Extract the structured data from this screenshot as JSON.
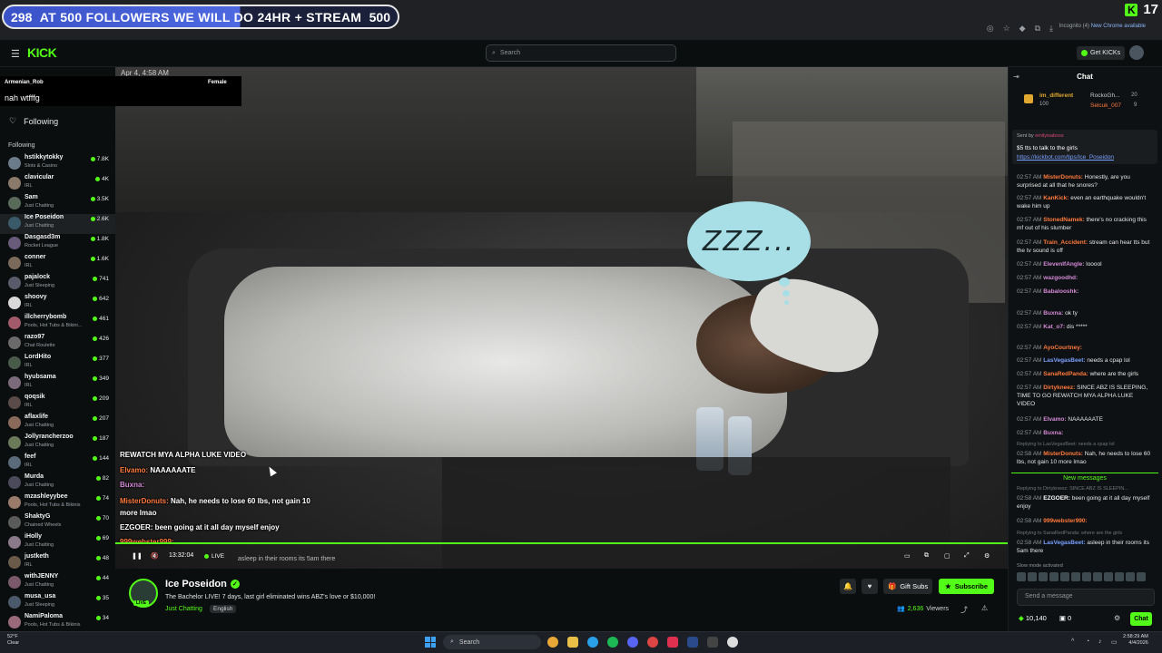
{
  "follow_goal": {
    "current": "298",
    "text": "AT 500 FOLLOWERS WE WILL DO 24HR + STREAM",
    "target": "500"
  },
  "corner_badge": {
    "value": "17"
  },
  "browser": {
    "incognito": "Incognito (4)",
    "new_chrome": "New Chrome available"
  },
  "header": {
    "search_placeholder": "Search",
    "get_kicks": "Get KICKs"
  },
  "popup": {
    "username": "Armenian_Rob",
    "gender": "Female",
    "message": "nah wtfffg"
  },
  "sidebar": {
    "nav_following": "Following",
    "section_title": "Following",
    "items": [
      {
        "name": "hstikkytokky",
        "category": "Slots & Casino",
        "viewers": "7.8K",
        "color": "#6b7b8a"
      },
      {
        "name": "clavicular",
        "category": "IRL",
        "viewers": "4K",
        "color": "#8a7a6a"
      },
      {
        "name": "Sam",
        "category": "Just Chatting",
        "viewers": "3.5K",
        "color": "#5a6a5a"
      },
      {
        "name": "Ice Poseidon",
        "category": "Just Chatting",
        "viewers": "2.6K",
        "color": "#3a5a6a"
      },
      {
        "name": "Dasgasd3m",
        "category": "Rocket League",
        "viewers": "1.8K",
        "color": "#6a5a7a"
      },
      {
        "name": "conner",
        "category": "IRL",
        "viewers": "1.6K",
        "color": "#7a6a5a"
      },
      {
        "name": "pajalock",
        "category": "Just Sleeping",
        "viewers": "741",
        "color": "#5a5a6a"
      },
      {
        "name": "shoovy",
        "category": "IRL",
        "viewers": "642",
        "color": "#d9d9d9"
      },
      {
        "name": "illcherrybomb",
        "category": "Pools, Hot Tubs & Bikini...",
        "viewers": "461",
        "color": "#a05a6a"
      },
      {
        "name": "razo97",
        "category": "Chat Roulette",
        "viewers": "426",
        "color": "#6a6a6a"
      },
      {
        "name": "LordHito",
        "category": "IRL",
        "viewers": "377",
        "color": "#4a5a4a"
      },
      {
        "name": "hyubsama",
        "category": "IRL",
        "viewers": "349",
        "color": "#7a6a7a"
      },
      {
        "name": "qoqsik",
        "category": "IRL",
        "viewers": "209",
        "color": "#5a4a4a"
      },
      {
        "name": "aflaxlife",
        "category": "Just Chatting",
        "viewers": "207",
        "color": "#8a6a5a"
      },
      {
        "name": "Jollyrancherzoo",
        "category": "Just Chatting",
        "viewers": "187",
        "color": "#6a7a5a"
      },
      {
        "name": "feef",
        "category": "IRL",
        "viewers": "144",
        "color": "#5a6a7a"
      },
      {
        "name": "Murda",
        "category": "Just Chatting",
        "viewers": "82",
        "color": "#4a4a5a"
      },
      {
        "name": "mzashleyybee",
        "category": "Pools, Hot Tubs & Bikinis",
        "viewers": "74",
        "color": "#9a7a6a"
      },
      {
        "name": "ShaktyG",
        "category": "Chained Wheels",
        "viewers": "70",
        "color": "#5a5a5a"
      },
      {
        "name": "iHolly",
        "category": "Just Chatting",
        "viewers": "69",
        "color": "#8a7a8a"
      },
      {
        "name": "justketh",
        "category": "IRL",
        "viewers": "48",
        "color": "#6a5a4a"
      },
      {
        "name": "withJENNY",
        "category": "Just Chatting",
        "viewers": "44",
        "color": "#7a5a6a"
      },
      {
        "name": "musa_usa",
        "category": "Just Sleeping",
        "viewers": "35",
        "color": "#4a5a6a"
      },
      {
        "name": "NamiPaloma",
        "category": "Pools, Hot Tubs & Bikinis",
        "viewers": "34",
        "color": "#9a6a7a"
      }
    ]
  },
  "video": {
    "timestamp_overlay": "Apr 4, 4:58 AM",
    "zzz": "ZZZ...",
    "overlay_chat": [
      {
        "user": "",
        "text": "REWATCH MYA ALPHA LUKE VIDEO",
        "cls": ""
      },
      {
        "user": "Elvamo:",
        "text": " NAAAAAATE",
        "cls": "u1"
      },
      {
        "user": "Buxna:",
        "text": "",
        "cls": "u2"
      },
      {
        "user": "MisterDonuts:",
        "text": " Nah, he needs to lose 60 lbs, not gain 10",
        "cls": "u1"
      },
      {
        "user": "",
        "text": "more lmao",
        "cls": ""
      },
      {
        "user": "EZGOER:",
        "text": " been going at it all day myself enjoy",
        "cls": ""
      },
      {
        "user": "999webster999:",
        "text": "",
        "cls": "u1"
      }
    ],
    "time": "13:32:04",
    "live": "LIVE",
    "overlay_bottom_text": "asleep in their rooms its 5am there"
  },
  "stream": {
    "name": "Ice Poseidon",
    "title": "The Bachelor LIVE! 7 days, last girl eliminated wins ABZ's love or $10,000!",
    "category": "Just Chatting",
    "language": "English",
    "gift_subs": "Gift Subs",
    "subscribe": "Subscribe",
    "viewers_count": "2,636",
    "viewers_label": "Viewers",
    "live_badge": "LIVE"
  },
  "chat": {
    "title": "Chat",
    "leaderboard": [
      {
        "name": "im_different",
        "value": "100"
      },
      {
        "name": "RockoGh...",
        "value": "20"
      },
      {
        "name": "Selcuk_007",
        "value": "9"
      }
    ],
    "pinned_sender": "Sent by",
    "pinned_sender_name": "emilyisaboss",
    "pinned_text": "$5 tts to talk to the girls",
    "pinned_link": "https://kickbot.com/tips/Ice_Poseidon",
    "messages": [
      {
        "time": "02:57 AM",
        "user": "MisterDonuts:",
        "text": " Honestly, are you surprised at all that he snores?",
        "color": "#ff7a3d"
      },
      {
        "time": "02:57 AM",
        "user": "KanKick:",
        "text": " even an earthquake wouldn't wake him up",
        "color": "#ff7a3d"
      },
      {
        "time": "02:57 AM",
        "user": "StonedNamek:",
        "text": " there's no cracking this mf out of his slumber",
        "color": "#ff7a3d"
      },
      {
        "time": "02:57 AM",
        "user": "Train_Accident:",
        "text": " stream can hear tts but the tv sound is off",
        "color": "#ff7a3d"
      },
      {
        "time": "02:57 AM",
        "user": "ElevenIfAngle:",
        "text": " looool",
        "color": "#d48ad6"
      },
      {
        "time": "02:57 AM",
        "user": "wazgoodhd:",
        "text": "",
        "color": "#d48ad6"
      },
      {
        "time": "02:57 AM",
        "user": "Babalooshk:",
        "text": "",
        "color": "#d48ad6"
      },
      {
        "time": "02:57 AM",
        "user": "Buxna:",
        "text": " ok ty",
        "color": "#d48ad6"
      },
      {
        "time": "02:57 AM",
        "user": "Kat_o7:",
        "text": " dis *****",
        "color": "#d48ad6"
      },
      {
        "time": "02:57 AM",
        "user": "AyoCourtney:",
        "text": "",
        "color": "#ff7a3d"
      },
      {
        "time": "02:57 AM",
        "user": "LasVegasBeet:",
        "text": " needs a cpap lol",
        "color": "#7aa0ff"
      },
      {
        "time": "02:57 AM",
        "user": "SanaRedPanda:",
        "text": " where are the girls",
        "color": "#ff7a3d"
      },
      {
        "time": "02:57 AM",
        "user": "Dirtykneez:",
        "text": " SINCE ABZ IS SLEEPING, TIME TO GO REWATCH MYA ALPHA LUKE VIDEO",
        "color": "#ff7a3d"
      },
      {
        "time": "02:57 AM",
        "user": "Elvamo:",
        "text": " NAAAAAATE",
        "color": "#d48ad6"
      },
      {
        "time": "02:57 AM",
        "user": "Buxna:",
        "text": "",
        "color": "#d48ad6"
      },
      {
        "time": "02:58 AM",
        "user": "MisterDonuts:",
        "text": " Nah, he needs to lose 60 lbs, not gain 10 more lmao",
        "color": "#ff7a3d"
      },
      {
        "time": "02:58 AM",
        "user": "EZGOER:",
        "text": " been going at it all day myself enjoy",
        "color": "#ffffff"
      },
      {
        "time": "02:58 AM",
        "user": "999webster990:",
        "text": "",
        "color": "#ff7a3d"
      },
      {
        "time": "02:58 AM",
        "user": "LasVegasBeet:",
        "text": " asleep in their rooms its 5am there",
        "color": "#7aa0ff"
      }
    ],
    "replies": [
      "Replying to LasVegasBeet: needs a cpap lol",
      "Replying to Dirtykneez: SINCE ABZ IS SLEEPIN...",
      "Replying to SanaRedPanda: where are the girls"
    ],
    "new_messages": "New messages",
    "slow_mode": "Slow mode activated",
    "input_placeholder": "Send a message",
    "kicks_balance": "10,140",
    "other_balance": "0",
    "chat_button": "Chat"
  },
  "taskbar": {
    "weather_temp": "52°F",
    "weather_desc": "Clear",
    "search": "Search",
    "time": "2:58:29 AM",
    "date": "4/4/2026"
  }
}
